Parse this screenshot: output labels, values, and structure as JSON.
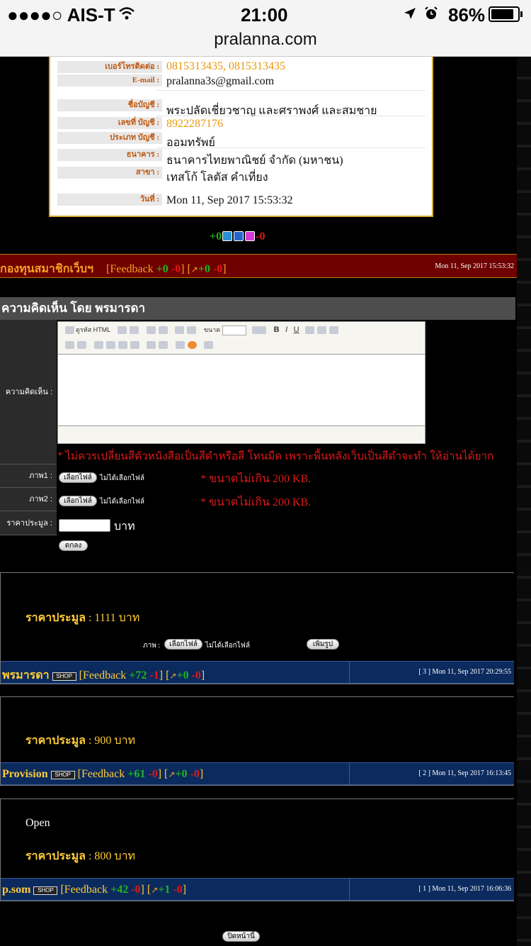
{
  "status": {
    "carrier": "●●●●○ AIS-T",
    "time": "21:00",
    "battery": "86%",
    "url": "pralanna.com"
  },
  "info": {
    "phone_label": "เบอร์โทรติดต่อ :",
    "phone_value": "0815313435, 0815313435",
    "email_label": "E-mail :",
    "email_value": "pralanna3s@gmail.com",
    "acct_name_label": "ชื่อบัญชี :",
    "acct_name_value": "พระปลัดเชี่ยวชาญ และศราพงศ์ และสมชาย",
    "acct_no_label": "เลขที่ บัญชี :",
    "acct_no_value": "8922287176",
    "acct_type_label": "ประเภท บัญชี :",
    "acct_type_value": "ออมทรัพย์",
    "bank_label": "ธนาคาร :",
    "bank_value": "ธนาคารไทยพาณิชย์ จำกัด (มหาชน)",
    "branch_label": "สาขา :",
    "branch_value": "เทสโก้ โลตัส คำเที่ยง",
    "date_label": "วันที่ :",
    "date_value": "Mon 11, Sep 2017 15:53:32"
  },
  "score": {
    "plus": "+0",
    "minus": "-0"
  },
  "seller_bar": {
    "name": "กองทุนสมาชิกเว็บฯ",
    "fb_open": "[Feedback",
    "fb_plus": "+0",
    "fb_minus": "-0",
    "close1": "]",
    "bid_open": "[",
    "bid_plus": "+0",
    "bid_minus": "-0",
    "close2": "]",
    "date": "Mon 11, Sep 2017 15:53:32"
  },
  "form": {
    "title": "ความคิดเห็น โดย พรมารดา",
    "comment_label": "ความคิดเห็น :",
    "source_html": "ดูรหัส HTML",
    "size_label": "ขนาด",
    "warning": "* ไม่ควรเปลี่ยนสีตัวหนังสือเป็นสีดำหรือสี โทนมืด เพราะพื้นหลังเว็บเป็นสีดำจะทำ ให้อ่านได้ยาก",
    "img1_label": "ภาพ1 :",
    "img2_label": "ภาพ2 :",
    "choose_file": "เลือกไฟล์",
    "no_file": "ไม่ได้เลือกไฟล์",
    "size_note": "* ขนาดไม่เกิน 200 KB.",
    "price_label": "ราคาประมูล :",
    "price_unit": "บาท",
    "submit": "ตกลง"
  },
  "posts": [
    {
      "text": "",
      "price_label": "ราคาประมูล",
      "price_value": ": 1111 บาท",
      "img_label": "ภาพ :",
      "add_pic": "เพิ่มรูป",
      "user": "พรมารดา",
      "fb_plus": "+72",
      "fb_minus": "-1",
      "bid_plus": "+0",
      "bid_minus": "-0",
      "meta": "[ 3 ] Mon 11, Sep 2017 20:29:55"
    },
    {
      "text": "",
      "price_label": "ราคาประมูล",
      "price_value": ": 900 บาท",
      "user": "Provision",
      "fb_plus": "+61",
      "fb_minus": "-0",
      "bid_plus": "+0",
      "bid_minus": "-0",
      "meta": "[ 2 ] Mon 11, Sep 2017 16:13:45"
    },
    {
      "text": "Open",
      "price_label": "ราคาประมูล",
      "price_value": ": 800 บาท",
      "user": "p.som",
      "fb_plus": "+42",
      "fb_minus": "-0",
      "bid_plus": "+1",
      "bid_minus": "-0",
      "meta": "[ 1 ] Mon 11, Sep 2017 16:06:36"
    }
  ],
  "shop_badge": "SHOP",
  "fb_word": "[Feedback",
  "close_page": "ปิดหน้านี้"
}
